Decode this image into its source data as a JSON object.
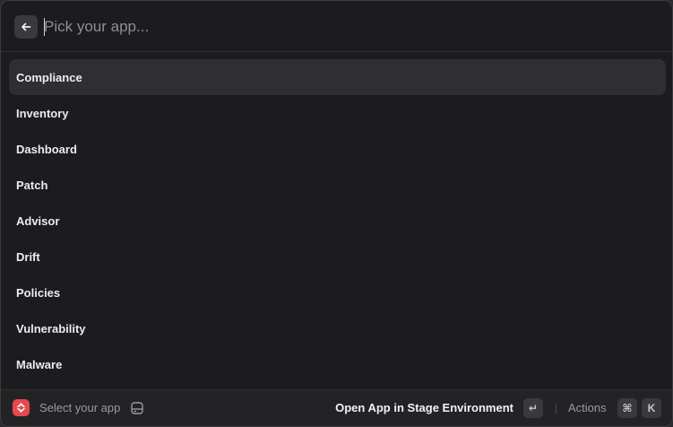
{
  "search": {
    "placeholder": "Pick your app...",
    "value": ""
  },
  "list": {
    "items": [
      {
        "label": "Compliance",
        "selected": true
      },
      {
        "label": "Inventory"
      },
      {
        "label": "Dashboard"
      },
      {
        "label": "Patch"
      },
      {
        "label": "Advisor"
      },
      {
        "label": "Drift"
      },
      {
        "label": "Policies"
      },
      {
        "label": "Vulnerability"
      },
      {
        "label": "Malware"
      }
    ]
  },
  "footer": {
    "title": "Select your app",
    "primary_action": "Open App in Stage Environment",
    "enter_key": "↵",
    "actions_label": "Actions",
    "cmd_key": "⌘",
    "k_key": "K"
  },
  "icons": {
    "back": "arrow-left-icon",
    "logo": "app-logo-icon",
    "hint": "tray-icon"
  },
  "colors": {
    "background": "#1c1c1e",
    "selected_row": "#2f2f32",
    "logo": "#e5484d",
    "text": "#ececee",
    "muted_text": "#9a9a9f"
  }
}
